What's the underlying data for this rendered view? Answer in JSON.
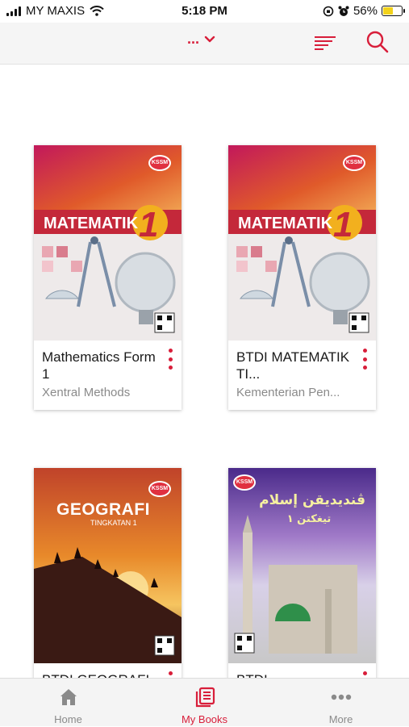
{
  "status_bar": {
    "carrier": "MY MAXIS",
    "time": "5:18 PM",
    "battery_percent": "56%",
    "battery_level": 0.56,
    "icons": [
      "signal-icon",
      "wifi-icon",
      "orientation-lock-icon",
      "alarm-icon",
      "battery-icon"
    ]
  },
  "header": {
    "title": "...",
    "icons": [
      "chevron-down-icon",
      "sort-icon",
      "search-icon"
    ],
    "accent_color": "#d81e3a"
  },
  "books": [
    {
      "title": "Mathematics Form 1",
      "author": "Xentral Methods",
      "cover_title": "MATEMATIK",
      "cover_number": "1",
      "cover_badge": "KSSM"
    },
    {
      "title": "BTDI MATEMATIK TI...",
      "author": "Kementerian Pen...",
      "cover_title": "MATEMATIK",
      "cover_number": "1",
      "cover_badge": "KSSM"
    },
    {
      "title": "BTDI GEOGRAFI",
      "author": "",
      "cover_title": "GEOGRAFI",
      "cover_subtitle": "TINGKATAN 1",
      "cover_badge": "KSSM"
    },
    {
      "title": "BTDI",
      "author": "",
      "cover_title": "ڤنديديقن إسلام",
      "cover_subtitle": "تيغكتن ١",
      "cover_badge": "KSSM"
    }
  ],
  "tab_bar": {
    "tabs": [
      {
        "label": "Home",
        "icon": "home-icon",
        "active": false
      },
      {
        "label": "My Books",
        "icon": "my-books-icon",
        "active": true
      },
      {
        "label": "More",
        "icon": "more-icon",
        "active": false
      }
    ]
  }
}
